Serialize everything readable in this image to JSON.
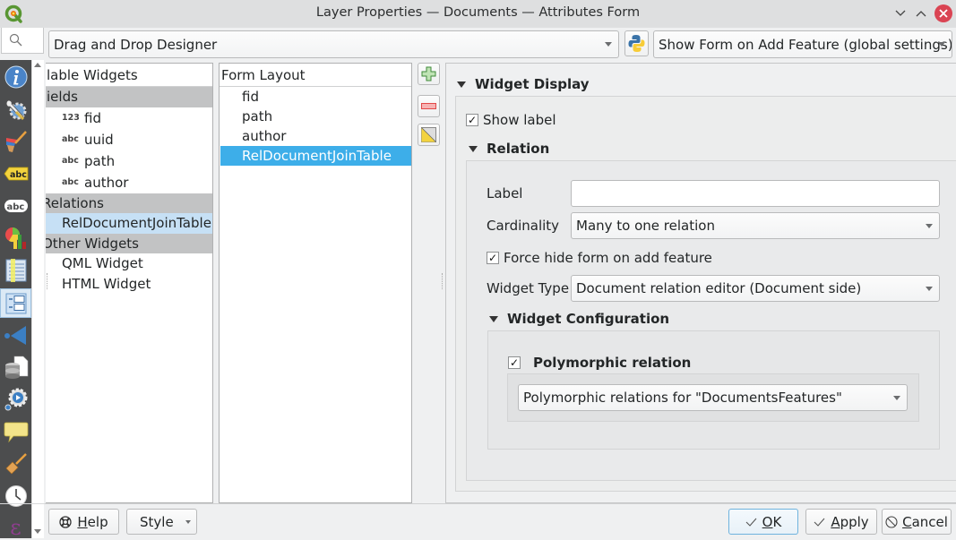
{
  "window": {
    "title": "Layer Properties — Documents — Attributes Form",
    "icons": {
      "app": "qgis-logo-icon",
      "minimize": "chevron-down-icon",
      "maximize": "chevron-up-icon",
      "close": "close-icon"
    },
    "minimize_glyph": "⌄",
    "maximize_glyph": "⌃",
    "close_glyph": "✕"
  },
  "toolbar": {
    "search_placeholder": "",
    "designer_mode": "Drag and Drop Designer",
    "python_icon": "python-icon",
    "form_suppress": "Show Form on Add Feature (global settings)"
  },
  "sidebar": {
    "items": [
      {
        "name": "information",
        "icon": "info-icon"
      },
      {
        "name": "source",
        "icon": "source-settings-icon"
      },
      {
        "name": "symbology",
        "icon": "symbology-brush-icon"
      },
      {
        "name": "labels",
        "icon": "labels-icon"
      },
      {
        "name": "masks",
        "icon": "masks-abc-icon"
      },
      {
        "name": "diagrams",
        "icon": "diagrams-icon"
      },
      {
        "name": "fields",
        "icon": "fields-table-icon"
      },
      {
        "name": "attributes-form",
        "icon": "attributes-form-icon",
        "active": true
      },
      {
        "name": "joins",
        "icon": "joins-icon"
      },
      {
        "name": "auxiliary-storage",
        "icon": "auxiliary-storage-icon"
      },
      {
        "name": "actions",
        "icon": "actions-icon"
      },
      {
        "name": "display",
        "icon": "display-tooltip-icon"
      },
      {
        "name": "rendering",
        "icon": "rendering-brush-icon"
      },
      {
        "name": "temporal",
        "icon": "temporal-clock-icon"
      },
      {
        "name": "variables",
        "icon": "variables-epsilon-icon"
      }
    ]
  },
  "available_widgets": {
    "header": "Available Widgets",
    "header_visible": "lable Widgets",
    "groups": [
      {
        "label": "Fields",
        "label_visible": "ields",
        "items": [
          {
            "type": "123",
            "label": "fid"
          },
          {
            "type": "abc",
            "label": "uuid"
          },
          {
            "type": "abc",
            "label": "path"
          },
          {
            "type": "abc",
            "label": "author"
          }
        ]
      },
      {
        "label": "Relations",
        "label_visible": "Relations",
        "items": [
          {
            "label": "RelDocumentJoinTable",
            "selected": true
          }
        ]
      },
      {
        "label": "Other Widgets",
        "label_visible": "Other Widgets",
        "items": [
          {
            "label": "QML Widget"
          },
          {
            "label": "HTML Widget"
          }
        ]
      }
    ]
  },
  "form_layout": {
    "header": "Form Layout",
    "items": [
      {
        "label": "fid"
      },
      {
        "label": "path"
      },
      {
        "label": "author"
      },
      {
        "label": "RelDocumentJoinTable",
        "selected": true
      }
    ],
    "buttons": {
      "add": "add-icon",
      "remove": "remove-icon",
      "edit": "edit-container-icon"
    }
  },
  "config": {
    "widget_display": {
      "title": "Widget Display",
      "show_label": {
        "label": "Show label",
        "checked": true
      }
    },
    "relation": {
      "title": "Relation",
      "label_field": {
        "label": "Label",
        "value": ""
      },
      "cardinality": {
        "label": "Cardinality",
        "value": "Many to one relation"
      },
      "force_hide": {
        "label": "Force hide form on add feature",
        "checked": true
      },
      "widget_type": {
        "label": "Widget Type",
        "value": "Document relation editor (Document side)"
      }
    },
    "widget_configuration": {
      "title": "Widget Configuration",
      "polymorphic": {
        "label": "Polymorphic relation",
        "checked": true
      },
      "polymorphic_value": "Polymorphic relations for \"DocumentsFeatures\""
    },
    "check_glyph": "✓"
  },
  "footer": {
    "help": {
      "label": "Help",
      "mnemonic": "H",
      "rest": "elp",
      "icon": "help-lifebuoy-icon"
    },
    "style": {
      "label": "Style"
    },
    "ok": {
      "label": "OK",
      "mnemonic": "O",
      "rest": "K",
      "icon": "check-icon"
    },
    "apply": {
      "label": "Apply",
      "mnemonic": "A",
      "rest": "pply",
      "icon": "check-icon"
    },
    "cancel": {
      "label": "Cancel",
      "mnemonic": "C",
      "rest": "ancel",
      "icon": "cancel-circle-icon"
    }
  }
}
